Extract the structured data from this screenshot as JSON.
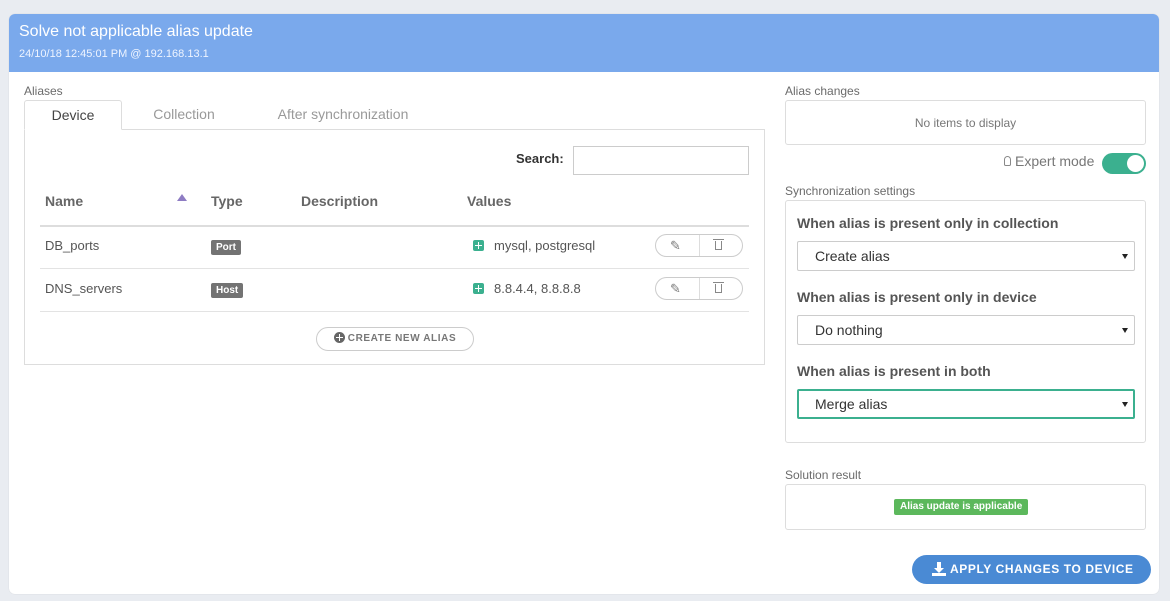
{
  "header": {
    "title": "Solve not applicable alias update",
    "subtitle": "24/10/18 12:45:01 PM @ 192.168.13.1"
  },
  "aliases": {
    "section_label": "Aliases",
    "tabs": [
      {
        "label": "Device",
        "active": true
      },
      {
        "label": "Collection",
        "active": false
      },
      {
        "label": "After synchronization",
        "active": false
      }
    ],
    "search": {
      "label": "Search:",
      "value": "",
      "placeholder": ""
    },
    "columns": {
      "name": "Name",
      "type": "Type",
      "description": "Description",
      "values": "Values"
    },
    "sort": {
      "column": "Name",
      "direction": "ascending"
    },
    "rows": [
      {
        "name": "DB_ports",
        "type": "Port",
        "description": "",
        "values": "mysql, postgresql"
      },
      {
        "name": "DNS_servers",
        "type": "Host",
        "description": "",
        "values": "8.8.4.4, 8.8.8.8"
      }
    ],
    "create_label": "CREATE NEW ALIAS"
  },
  "alias_changes": {
    "label": "Alias changes",
    "empty_text": "No items to display"
  },
  "expert_mode": {
    "label": "Expert mode",
    "enabled": true
  },
  "sync_settings": {
    "label": "Synchronization settings",
    "rules": [
      {
        "label": "When alias is present only in collection",
        "value": "Create alias"
      },
      {
        "label": "When alias is present only in device",
        "value": "Do nothing"
      },
      {
        "label": "When alias is present in both",
        "value": "Merge alias"
      }
    ]
  },
  "solution": {
    "label": "Solution result",
    "status": "Alias update is applicable"
  },
  "apply_label": "APPLY CHANGES TO DEVICE",
  "colors": {
    "header": "#7aa9ec",
    "accent_green": "#3bb08f",
    "success_badge": "#5cb85c",
    "primary_button": "#4a8ad4",
    "type_badge": "#737373"
  }
}
